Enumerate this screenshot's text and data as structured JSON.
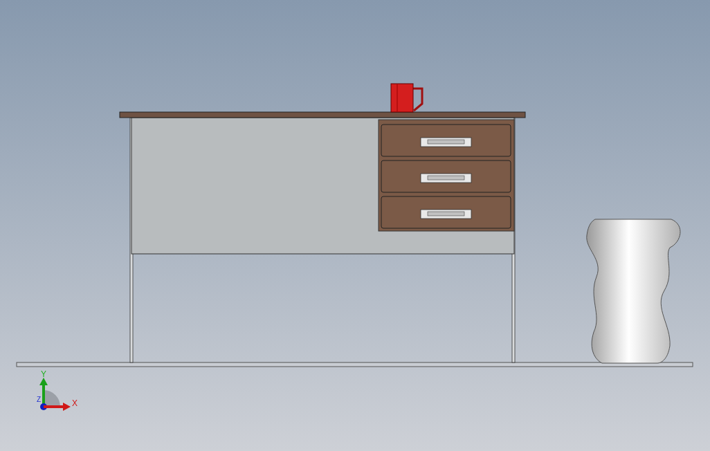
{
  "viewport": {
    "triad": {
      "axes": [
        {
          "kind": "y",
          "label": "Y"
        },
        {
          "kind": "z",
          "label": "Z"
        },
        {
          "kind": "x",
          "label": "X"
        }
      ]
    }
  }
}
